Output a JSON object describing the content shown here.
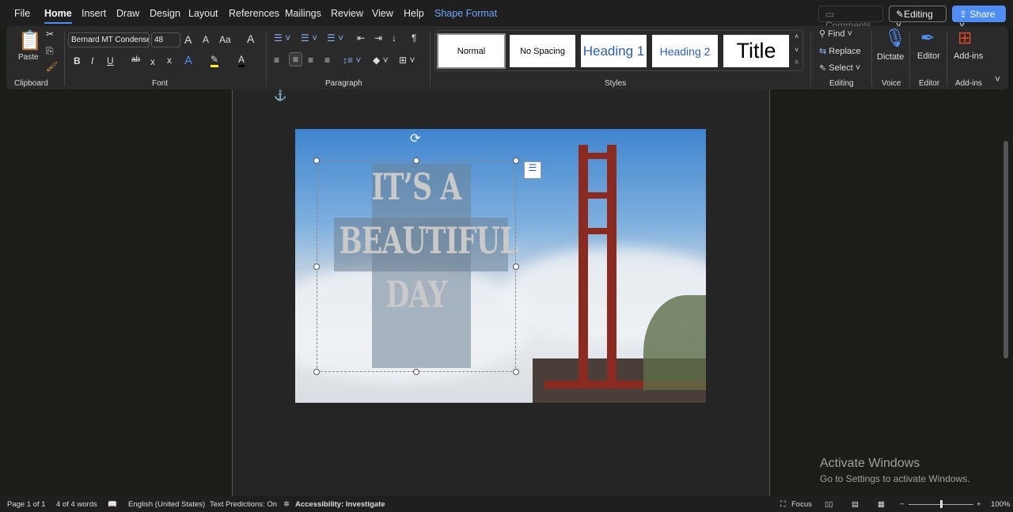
{
  "menu": [
    "File",
    "Home",
    "Insert",
    "Draw",
    "Design",
    "Layout",
    "References",
    "Mailings",
    "Review",
    "View",
    "Help",
    "Shape Format"
  ],
  "top": {
    "comments": "Comments",
    "editing": "Editing",
    "share": "Share"
  },
  "clipboard": {
    "paste": "Paste",
    "label": "Clipboard"
  },
  "font": {
    "name": "Bernard MT Condensed",
    "size": "48",
    "label": "Font",
    "grow": "A",
    "shrink": "A",
    "case": "Aa",
    "bold": "B",
    "italic": "I",
    "underline": "U",
    "strike": "ab",
    "sub": "x",
    "sup": "x"
  },
  "paragraph": {
    "label": "Paragraph",
    "pilcrow": "¶"
  },
  "styles": {
    "label": "Styles",
    "items": [
      "Normal",
      "No Spacing",
      "Heading 1",
      "Heading 2",
      "Title"
    ]
  },
  "editing": {
    "find": "Find",
    "replace": "Replace",
    "select": "Select",
    "label": "Editing"
  },
  "voice": {
    "dictate": "Dictate",
    "label": "Voice"
  },
  "editor": {
    "btn": "Editor",
    "label": "Editor"
  },
  "addins": {
    "btn": "Add-ins",
    "label": "Add-ins"
  },
  "doc": {
    "lines": [
      "IT’S A",
      "BEAUTIFUL",
      "DAY"
    ]
  },
  "status": {
    "page": "Page 1 of 1",
    "words": "4 of 4 words",
    "lang": "English (United States)",
    "pred": "Text Predictions: On",
    "access": "Accessibility: Investigate",
    "focus": "Focus",
    "zoom": "100%"
  },
  "watermark": {
    "title": "Activate Windows",
    "sub": "Go to Settings to activate Windows."
  },
  "colors": {
    "accent": "#4f8df5",
    "share": "#4f8df5"
  }
}
